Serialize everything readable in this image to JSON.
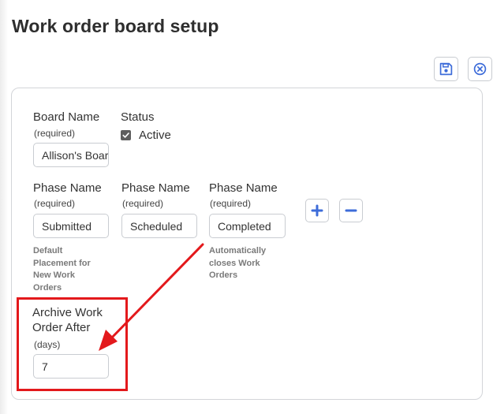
{
  "page": {
    "title": "Work order board setup"
  },
  "toolbar": {
    "save_icon": "floppy-disk-icon",
    "cancel_icon": "circle-x-icon",
    "accent_color": "#3d6cd9"
  },
  "board_name": {
    "label": "Board Name",
    "required": "(required)",
    "value": "Allison's Board"
  },
  "status": {
    "label": "Status",
    "checkbox_label": "Active",
    "checked": true
  },
  "phases": [
    {
      "label": "Phase Name",
      "required": "(required)",
      "value": "Submitted",
      "hint": [
        "Default",
        "Placement for",
        "New Work",
        "Orders"
      ]
    },
    {
      "label": "Phase Name",
      "required": "(required)",
      "value": "Scheduled",
      "hint": []
    },
    {
      "label": "Phase Name",
      "required": "(required)",
      "value": "Completed",
      "hint": [
        "Automatically",
        "closes Work",
        "Orders"
      ]
    }
  ],
  "phase_controls": {
    "add_icon": "plus-icon",
    "remove_icon": "minus-icon"
  },
  "archive": {
    "label_line1": "Archive Work",
    "label_line2": "Order After",
    "unit": "(days)",
    "value": "7"
  },
  "annotation": {
    "color": "#e3191c"
  }
}
